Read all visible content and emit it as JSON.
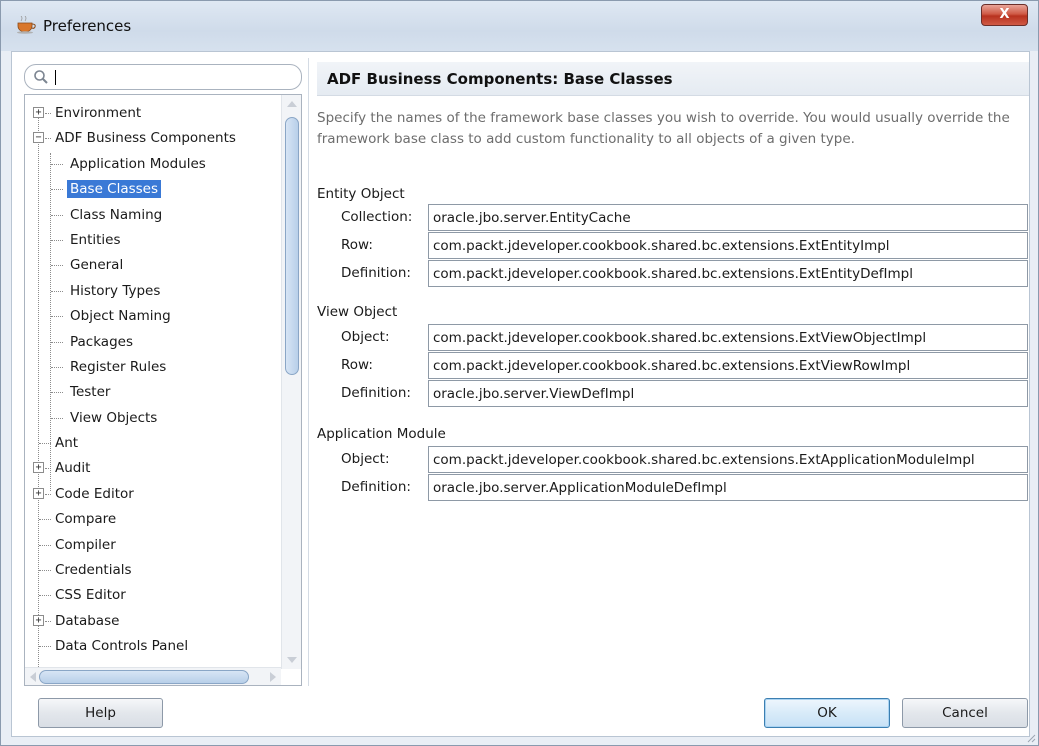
{
  "window": {
    "title": "Preferences",
    "close_label": "X"
  },
  "search": {
    "value": "",
    "placeholder": ""
  },
  "tree": {
    "items": [
      {
        "label": "Environment",
        "level": 0,
        "toggle": "+"
      },
      {
        "label": "ADF Business Components",
        "level": 0,
        "toggle": "−"
      },
      {
        "label": "Application Modules",
        "level": 1
      },
      {
        "label": "Base Classes",
        "level": 1,
        "selected": true
      },
      {
        "label": "Class Naming",
        "level": 1
      },
      {
        "label": "Entities",
        "level": 1
      },
      {
        "label": "General",
        "level": 1
      },
      {
        "label": "History Types",
        "level": 1
      },
      {
        "label": "Object Naming",
        "level": 1
      },
      {
        "label": "Packages",
        "level": 1
      },
      {
        "label": "Register Rules",
        "level": 1
      },
      {
        "label": "Tester",
        "level": 1
      },
      {
        "label": "View Objects",
        "level": 1
      },
      {
        "label": "Ant",
        "level": 0
      },
      {
        "label": "Audit",
        "level": 0,
        "toggle": "+"
      },
      {
        "label": "Code Editor",
        "level": 0,
        "toggle": "+"
      },
      {
        "label": "Compare",
        "level": 0
      },
      {
        "label": "Compiler",
        "level": 0
      },
      {
        "label": "Credentials",
        "level": 0
      },
      {
        "label": "CSS Editor",
        "level": 0
      },
      {
        "label": "Database",
        "level": 0,
        "toggle": "+"
      },
      {
        "label": "Data Controls Panel",
        "level": 0
      }
    ]
  },
  "panel": {
    "title": "ADF Business Components: Base Classes",
    "description": "Specify the names of the framework base classes you wish to override. You would usually override the framework base class to add custom functionality to all objects of a given type."
  },
  "groups": {
    "entity_object": {
      "label": "Entity Object",
      "collection_label": "Collection:",
      "collection_value": "oracle.jbo.server.EntityCache",
      "row_label": "Row:",
      "row_value": "com.packt.jdeveloper.cookbook.shared.bc.extensions.ExtEntityImpl",
      "definition_label": "Definition:",
      "definition_value": "com.packt.jdeveloper.cookbook.shared.bc.extensions.ExtEntityDefImpl"
    },
    "view_object": {
      "label": "View Object",
      "object_label": "Object:",
      "object_value": "com.packt.jdeveloper.cookbook.shared.bc.extensions.ExtViewObjectImpl",
      "row_label": "Row:",
      "row_value": "com.packt.jdeveloper.cookbook.shared.bc.extensions.ExtViewRowImpl",
      "definition_label": "Definition:",
      "definition_value": "oracle.jbo.server.ViewDefImpl"
    },
    "application_module": {
      "label": "Application Module",
      "object_label": "Object:",
      "object_value": "com.packt.jdeveloper.cookbook.shared.bc.extensions.ExtApplicationModuleImpl",
      "definition_label": "Definition:",
      "definition_value": "oracle.jbo.server.ApplicationModuleDefImpl"
    }
  },
  "buttons": {
    "help": "Help",
    "ok": "OK",
    "cancel": "Cancel"
  },
  "colors": {
    "selection": "#3a79d6",
    "titlebar": "#cfdbea",
    "close": "#c6432f"
  }
}
